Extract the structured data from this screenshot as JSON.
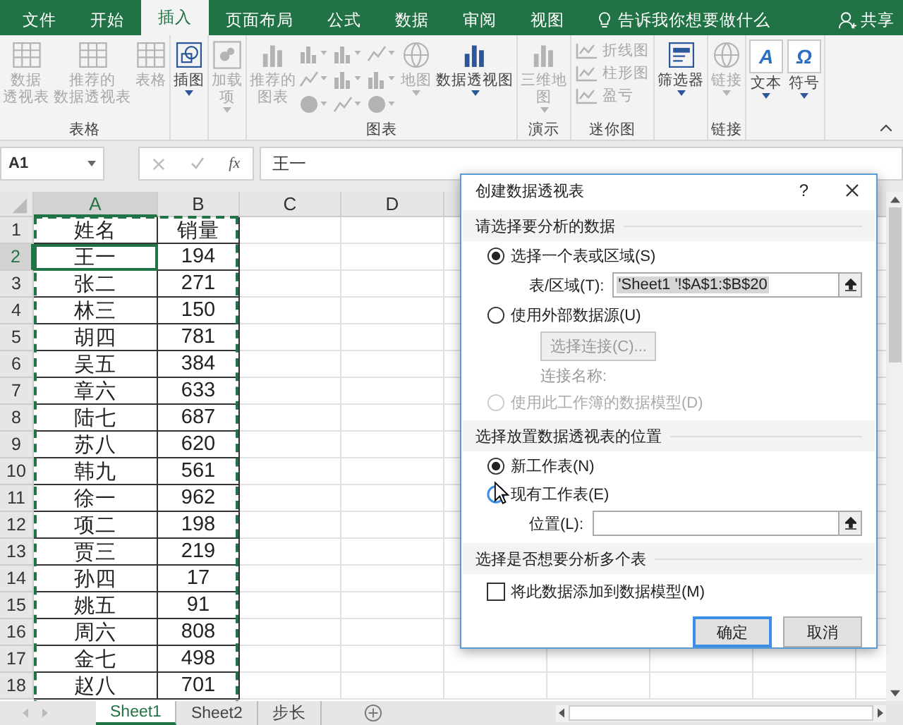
{
  "ribbon_tabs": [
    {
      "label": "文件",
      "selected": false
    },
    {
      "label": "开始",
      "selected": false
    },
    {
      "label": "插入",
      "selected": true
    },
    {
      "label": "页面布局",
      "selected": false
    },
    {
      "label": "公式",
      "selected": false
    },
    {
      "label": "数据",
      "selected": false
    },
    {
      "label": "审阅",
      "selected": false
    },
    {
      "label": "视图",
      "selected": false
    }
  ],
  "tell_me": "告诉我你想要做什么",
  "share": "共享",
  "ribbon_groups": [
    {
      "label": "表格",
      "buttons": [
        {
          "kind": "large",
          "label": "数据透视表",
          "disabled": true,
          "dropdown": false
        },
        {
          "kind": "large",
          "label": "推荐的数据透视表",
          "disabled": true,
          "dropdown": false
        },
        {
          "kind": "large",
          "label": "表格",
          "disabled": true,
          "dropdown": false
        }
      ]
    },
    {
      "buttons": [
        {
          "kind": "large",
          "label": "插图",
          "disabled": false,
          "dropdown": true
        }
      ]
    },
    {
      "buttons": [
        {
          "kind": "large",
          "label": "加载项",
          "disabled": true,
          "dropdown": true
        }
      ]
    },
    {
      "label": "图表",
      "buttons": [
        {
          "kind": "large",
          "label": "推荐的图表",
          "disabled": true,
          "dropdown": false
        },
        {
          "kind": "chart-grid",
          "disabled": true
        },
        {
          "kind": "large",
          "label": "地图",
          "disabled": true,
          "dropdown": true
        },
        {
          "kind": "large",
          "label": "数据透视图",
          "disabled": false,
          "dropdown": true
        }
      ]
    },
    {
      "label": "演示",
      "buttons": [
        {
          "kind": "large",
          "label": "三维地图",
          "disabled": true,
          "dropdown": true
        }
      ]
    },
    {
      "label": "迷你图",
      "buttons": [
        {
          "kind": "small",
          "label": "折线图",
          "disabled": true
        },
        {
          "kind": "small",
          "label": "柱形图",
          "disabled": true
        },
        {
          "kind": "small",
          "label": "盈亏",
          "disabled": true
        }
      ]
    },
    {
      "buttons": [
        {
          "kind": "large",
          "label": "筛选器",
          "disabled": false,
          "dropdown": true
        }
      ]
    },
    {
      "label": "链接",
      "buttons": [
        {
          "kind": "large",
          "label": "链接",
          "disabled": true,
          "dropdown": true
        }
      ]
    },
    {
      "buttons": [
        {
          "kind": "glyph",
          "glyph": "A",
          "label": "文本",
          "disabled": false,
          "dropdown": true
        },
        {
          "kind": "glyph",
          "glyph": "Ω",
          "label": "符号",
          "disabled": false,
          "dropdown": true
        }
      ]
    }
  ],
  "formula_bar": {
    "name_box": "A1",
    "function_label": "fx",
    "formula": "王一"
  },
  "sheet": {
    "columns": [
      {
        "label": "A",
        "selected": true
      },
      {
        "label": "B",
        "selected": false
      },
      {
        "label": "C",
        "selected": false
      },
      {
        "label": "D",
        "selected": false
      }
    ],
    "rows": [
      {
        "header": "1",
        "selected": false,
        "cells": [
          "姓名",
          "销量"
        ]
      },
      {
        "header": "2",
        "selected": true,
        "cells": [
          "王一",
          "194"
        ]
      },
      {
        "header": "3",
        "selected": false,
        "cells": [
          "张二",
          "271"
        ]
      },
      {
        "header": "4",
        "selected": false,
        "cells": [
          "林三",
          "150"
        ]
      },
      {
        "header": "5",
        "selected": false,
        "cells": [
          "胡四",
          "781"
        ]
      },
      {
        "header": "6",
        "selected": false,
        "cells": [
          "吴五",
          "384"
        ]
      },
      {
        "header": "7",
        "selected": false,
        "cells": [
          "章六",
          "633"
        ]
      },
      {
        "header": "8",
        "selected": false,
        "cells": [
          "陆七",
          "687"
        ]
      },
      {
        "header": "9",
        "selected": false,
        "cells": [
          "苏八",
          "620"
        ]
      },
      {
        "header": "10",
        "selected": false,
        "cells": [
          "韩九",
          "561"
        ]
      },
      {
        "header": "11",
        "selected": false,
        "cells": [
          "徐一",
          "962"
        ]
      },
      {
        "header": "12",
        "selected": false,
        "cells": [
          "项二",
          "198"
        ]
      },
      {
        "header": "13",
        "selected": false,
        "cells": [
          "贾三",
          "219"
        ]
      },
      {
        "header": "14",
        "selected": false,
        "cells": [
          "孙四",
          "17"
        ]
      },
      {
        "header": "15",
        "selected": false,
        "cells": [
          "姚五",
          "91"
        ]
      },
      {
        "header": "16",
        "selected": false,
        "cells": [
          "周六",
          "808"
        ]
      },
      {
        "header": "17",
        "selected": false,
        "cells": [
          "金七",
          "498"
        ]
      },
      {
        "header": "18",
        "selected": false,
        "cells": [
          "赵八",
          "701"
        ]
      }
    ]
  },
  "sheet_tabs": [
    {
      "label": "Sheet1",
      "selected": true
    },
    {
      "label": "Sheet2",
      "selected": false
    },
    {
      "label": "步长",
      "selected": false
    }
  ],
  "dialog": {
    "title": "创建数据透视表",
    "help": "?",
    "sections": [
      {
        "heading": "请选择要分析的数据",
        "items": [
          {
            "kind": "radio",
            "label": "选择一个表或区域(S)",
            "selected": true,
            "disabled": false,
            "hovered": false
          },
          {
            "kind": "field",
            "label": "表/区域(T):",
            "value": "'Sheet1 '!$A$1:$B$20"
          },
          {
            "kind": "radio",
            "label": "使用外部数据源(U)",
            "selected": false,
            "disabled": false,
            "hovered": false
          },
          {
            "kind": "button",
            "label": "选择连接(C)...",
            "disabled": true
          },
          {
            "kind": "note",
            "label": "连接名称:",
            "disabled": true
          },
          {
            "kind": "radio",
            "label": "使用此工作簿的数据模型(D)",
            "selected": false,
            "disabled": true,
            "hovered": false
          }
        ]
      },
      {
        "heading": "选择放置数据透视表的位置",
        "items": [
          {
            "kind": "radio",
            "label": "新工作表(N)",
            "selected": true,
            "disabled": false,
            "hovered": false
          },
          {
            "kind": "radio",
            "label": "现有工作表(E)",
            "selected": false,
            "disabled": false,
            "hovered": true
          },
          {
            "kind": "field",
            "label": "位置(L):"
          }
        ]
      },
      {
        "heading": "选择是否想要分析多个表",
        "items": [
          {
            "kind": "checkbox",
            "label": "将此数据添加到数据模型(M)",
            "checked": false
          }
        ]
      }
    ],
    "buttons": [
      {
        "label": "确定",
        "default": true
      },
      {
        "label": "取消",
        "default": false
      }
    ]
  }
}
